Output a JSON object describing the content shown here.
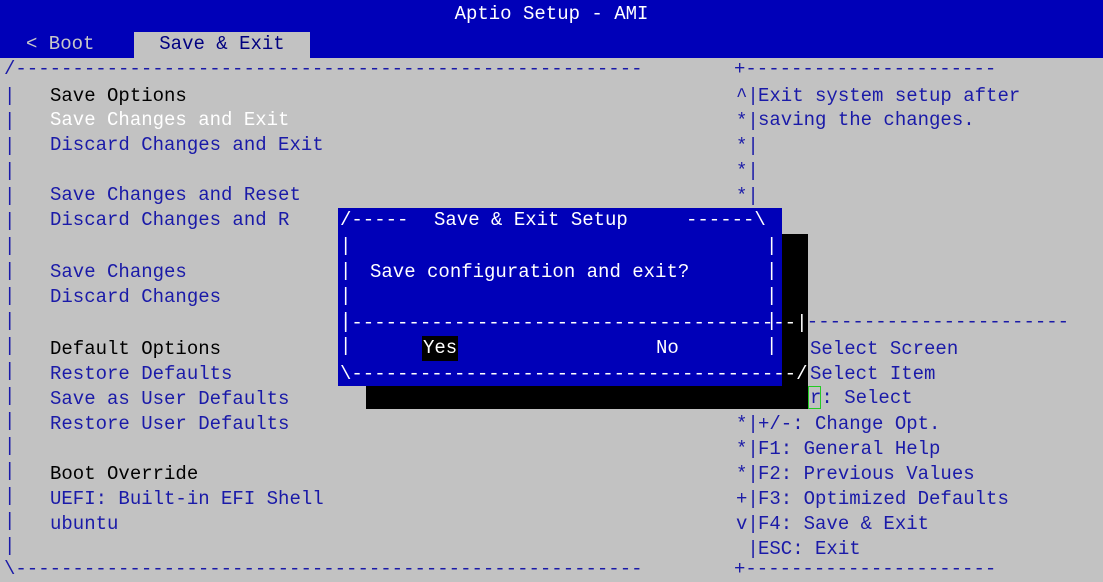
{
  "window": {
    "title": "Aptio Setup - AMI"
  },
  "tabs": {
    "prev": "< Boot",
    "active": "Save & Exit"
  },
  "menu": {
    "save_options_header": "Save Options",
    "save_changes_and_exit": "Save Changes and Exit",
    "discard_changes_and_exit": "Discard Changes and Exit",
    "save_changes_and_reset": "Save Changes and Reset",
    "discard_changes_and_reset_partial": "Discard Changes and R",
    "save_changes": "Save Changes",
    "discard_changes": "Discard Changes",
    "default_options_header": "Default Options",
    "restore_defaults": "Restore Defaults",
    "save_as_user_defaults": "Save as User Defaults",
    "restore_user_defaults": "Restore User Defaults",
    "boot_override_header": "Boot Override",
    "uefi_shell": "UEFI: Built-in EFI Shell",
    "ubuntu": "ubuntu"
  },
  "help": {
    "line1": "Exit system setup after",
    "line2": "saving the changes."
  },
  "keys": {
    "select_screen": "Select Screen",
    "select_item": "Select Item",
    "enter_select": "r: Select",
    "change_opt": "+/-: Change Opt.",
    "general_help": "F1: General Help",
    "previous_values": "F2: Previous Values",
    "optimized_defaults": "F3: Optimized Defaults",
    "save_exit": "F4: Save & Exit",
    "esc_exit": "ESC: Exit"
  },
  "dialog": {
    "title": "Save & Exit Setup",
    "message": "Save configuration and exit?",
    "yes": "Yes",
    "no": "No"
  },
  "colors": {
    "title_bar": "#0000b8",
    "background": "#c2c2c2",
    "item_text": "#1a1aa8",
    "dialog_bg": "#0000b8"
  }
}
